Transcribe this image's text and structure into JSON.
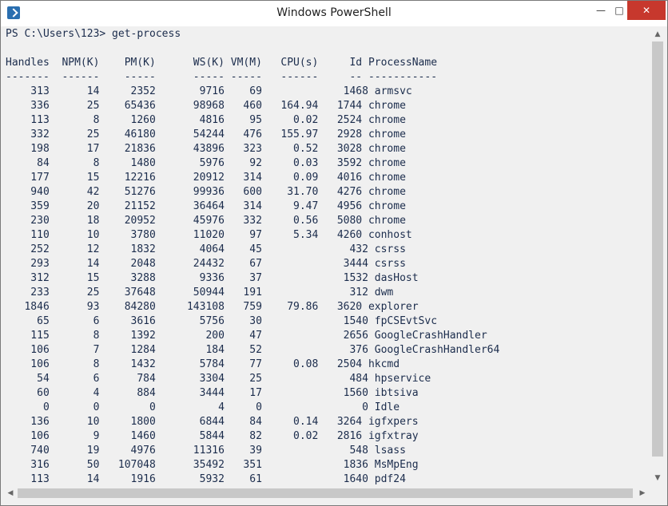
{
  "window": {
    "title": "Windows PowerShell"
  },
  "controls": {
    "minimize": "—",
    "maximize": "□",
    "close": "✕"
  },
  "console": {
    "lines": [
      "PS C:\\Users\\123> get-process",
      "",
      "Handles  NPM(K)    PM(K)      WS(K) VM(M)   CPU(s)     Id ProcessName",
      "-------  ------    -----      ----- -----   ------     -- -----------",
      "    313      14     2352       9716    69             1468 armsvc",
      "    336      25    65436      98968   460   164.94   1744 chrome",
      "    113       8     1260       4816    95     0.02   2524 chrome",
      "    332      25    46180      54244   476   155.97   2928 chrome",
      "    198      17    21836      43896   323     0.52   3028 chrome",
      "     84       8     1480       5976    92     0.03   3592 chrome",
      "    177      15    12216      20912   314     0.09   4016 chrome",
      "    940      42    51276      99936   600    31.70   4276 chrome",
      "    359      20    21152      36464   314     9.47   4956 chrome",
      "    230      18    20952      45976   332     0.56   5080 chrome",
      "    110      10     3780      11020    97     5.34   4260 conhost",
      "    252      12     1832       4064    45              432 csrss",
      "    293      14     2048      24432    67             3444 csrss",
      "    312      15     3288       9336    37             1532 dasHost",
      "    233      25    37648      50944   191              312 dwm",
      "   1846      93    84280     143108   759    79.86   3620 explorer",
      "     65       6     3616       5756    30             1540 fpCSEvtSvc",
      "    115       8     1392        200    47             2656 GoogleCrashHandler",
      "    106       7     1284        184    52              376 GoogleCrashHandler64",
      "    106       8     1432       5784    77     0.08   2504 hkcmd",
      "     54       6      784       3304    25              484 hpservice",
      "     60       4      884       3444    17             1560 ibtsiva",
      "      0       0        0          4     0                0 Idle",
      "    136      10     1800       6844    84     0.14   3264 igfxpers",
      "    106       9     1460       5844    82     0.02   2816 igfxtray",
      "    740      19     4976      11316    39              548 lsass",
      "    316      50   107048      35492   351             1836 MsMpEng",
      "    113      14     1916       5932    61             1640 pdf24"
    ]
  },
  "scrollbar": {
    "up": "▲",
    "down": "▼",
    "left": "◀",
    "right": "▶"
  }
}
